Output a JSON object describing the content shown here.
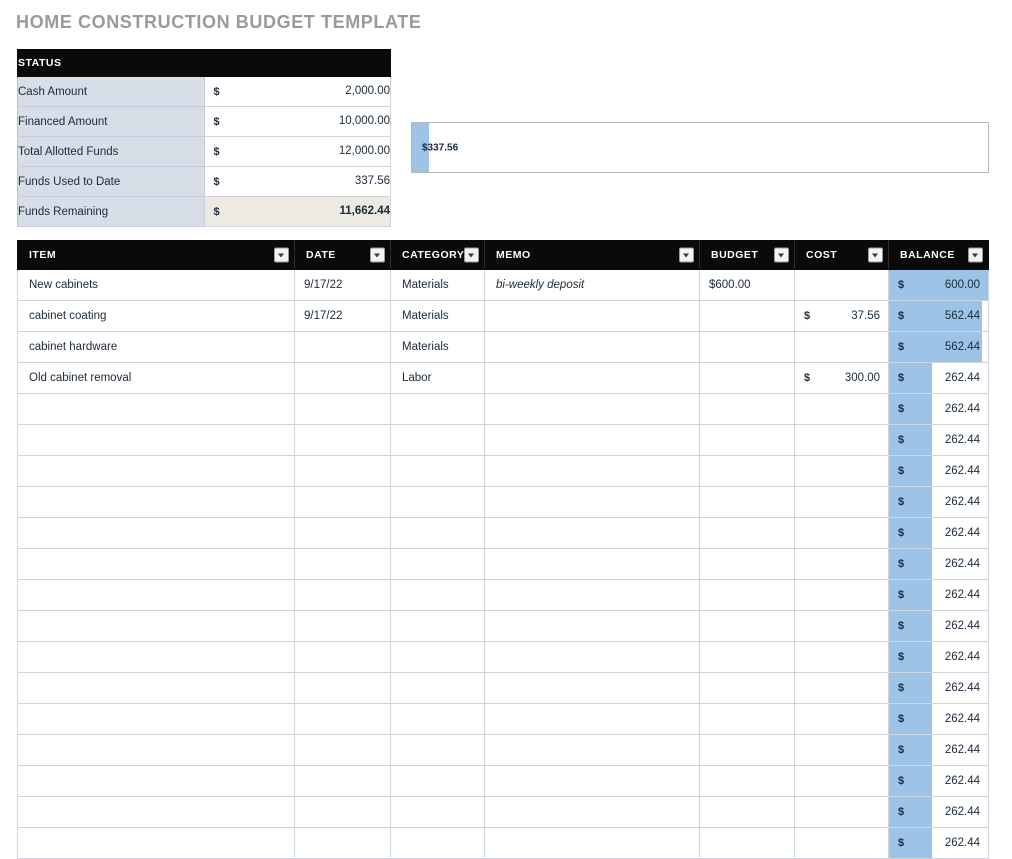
{
  "page": {
    "title": "HOME CONSTRUCTION BUDGET TEMPLATE",
    "title_color": "#9a9a9a",
    "accent_color": "#9dc3e6",
    "header_bg": "#0a0a0a",
    "row_stripe": "#d8dee8"
  },
  "status": {
    "header": "STATUS",
    "currency_symbol": "$",
    "rows": [
      {
        "label": "Cash Amount",
        "currency": "$",
        "value": "2,000.00",
        "bold": false,
        "highlight": false
      },
      {
        "label": "Financed Amount",
        "currency": "$",
        "value": "10,000.00",
        "bold": false,
        "highlight": false
      },
      {
        "label": "Total Allotted Funds",
        "currency": "$",
        "value": "12,000.00",
        "bold": false,
        "highlight": false
      },
      {
        "label": "Funds Used to Date",
        "currency": "$",
        "value": "337.56",
        "bold": false,
        "highlight": false
      },
      {
        "label": "Funds Remaining",
        "currency": "$",
        "value": "11,662.44",
        "bold": true,
        "highlight": true
      }
    ]
  },
  "chart_data": {
    "type": "bar",
    "orientation": "horizontal",
    "title": "",
    "xlabel": "",
    "ylabel": "",
    "categories": [
      "Funds Used to Date"
    ],
    "values": [
      337.56
    ],
    "data_labels": [
      "$337.56"
    ],
    "xlim": [
      0,
      12000
    ],
    "grid": false,
    "legend": false,
    "bar_color": "#9dc3e6",
    "plot_border_color": "#b7b7b7",
    "bar_fraction_of_plot": 0.03
  },
  "table": {
    "columns": [
      {
        "key": "item",
        "label": "ITEM",
        "has_filter": true
      },
      {
        "key": "date",
        "label": "DATE",
        "has_filter": true
      },
      {
        "key": "category",
        "label": "CATEGORY",
        "has_filter": true
      },
      {
        "key": "memo",
        "label": "MEMO",
        "has_filter": true
      },
      {
        "key": "budget",
        "label": "BUDGET",
        "has_filter": true
      },
      {
        "key": "cost",
        "label": "COST",
        "has_filter": true
      },
      {
        "key": "balance",
        "label": "BALANCE",
        "has_filter": true
      }
    ],
    "balance_bar_max": 600.0,
    "rows": [
      {
        "item": "New cabinets",
        "date": "9/17/22",
        "category": "Materials",
        "memo": "bi-weekly deposit",
        "budget": "$600.00",
        "cost_cur": "",
        "cost": "",
        "bal_cur": "$",
        "balance": "600.00",
        "balance_value": 600.0
      },
      {
        "item": "cabinet coating",
        "date": "9/17/22",
        "category": "Materials",
        "memo": "",
        "budget": "",
        "cost_cur": "$",
        "cost": "37.56",
        "bal_cur": "$",
        "balance": "562.44",
        "balance_value": 562.44
      },
      {
        "item": "cabinet hardware",
        "date": "",
        "category": "Materials",
        "memo": "",
        "budget": "",
        "cost_cur": "",
        "cost": "",
        "bal_cur": "$",
        "balance": "562.44",
        "balance_value": 562.44
      },
      {
        "item": "Old cabinet removal",
        "date": "",
        "category": "Labor",
        "memo": "",
        "budget": "",
        "cost_cur": "$",
        "cost": "300.00",
        "bal_cur": "$",
        "balance": "262.44",
        "balance_value": 262.44
      },
      {
        "item": "",
        "date": "",
        "category": "",
        "memo": "",
        "budget": "",
        "cost_cur": "",
        "cost": "",
        "bal_cur": "$",
        "balance": "262.44",
        "balance_value": 262.44
      },
      {
        "item": "",
        "date": "",
        "category": "",
        "memo": "",
        "budget": "",
        "cost_cur": "",
        "cost": "",
        "bal_cur": "$",
        "balance": "262.44",
        "balance_value": 262.44
      },
      {
        "item": "",
        "date": "",
        "category": "",
        "memo": "",
        "budget": "",
        "cost_cur": "",
        "cost": "",
        "bal_cur": "$",
        "balance": "262.44",
        "balance_value": 262.44
      },
      {
        "item": "",
        "date": "",
        "category": "",
        "memo": "",
        "budget": "",
        "cost_cur": "",
        "cost": "",
        "bal_cur": "$",
        "balance": "262.44",
        "balance_value": 262.44
      },
      {
        "item": "",
        "date": "",
        "category": "",
        "memo": "",
        "budget": "",
        "cost_cur": "",
        "cost": "",
        "bal_cur": "$",
        "balance": "262.44",
        "balance_value": 262.44
      },
      {
        "item": "",
        "date": "",
        "category": "",
        "memo": "",
        "budget": "",
        "cost_cur": "",
        "cost": "",
        "bal_cur": "$",
        "balance": "262.44",
        "balance_value": 262.44
      },
      {
        "item": "",
        "date": "",
        "category": "",
        "memo": "",
        "budget": "",
        "cost_cur": "",
        "cost": "",
        "bal_cur": "$",
        "balance": "262.44",
        "balance_value": 262.44
      },
      {
        "item": "",
        "date": "",
        "category": "",
        "memo": "",
        "budget": "",
        "cost_cur": "",
        "cost": "",
        "bal_cur": "$",
        "balance": "262.44",
        "balance_value": 262.44
      },
      {
        "item": "",
        "date": "",
        "category": "",
        "memo": "",
        "budget": "",
        "cost_cur": "",
        "cost": "",
        "bal_cur": "$",
        "balance": "262.44",
        "balance_value": 262.44
      },
      {
        "item": "",
        "date": "",
        "category": "",
        "memo": "",
        "budget": "",
        "cost_cur": "",
        "cost": "",
        "bal_cur": "$",
        "balance": "262.44",
        "balance_value": 262.44
      },
      {
        "item": "",
        "date": "",
        "category": "",
        "memo": "",
        "budget": "",
        "cost_cur": "",
        "cost": "",
        "bal_cur": "$",
        "balance": "262.44",
        "balance_value": 262.44
      },
      {
        "item": "",
        "date": "",
        "category": "",
        "memo": "",
        "budget": "",
        "cost_cur": "",
        "cost": "",
        "bal_cur": "$",
        "balance": "262.44",
        "balance_value": 262.44
      },
      {
        "item": "",
        "date": "",
        "category": "",
        "memo": "",
        "budget": "",
        "cost_cur": "",
        "cost": "",
        "bal_cur": "$",
        "balance": "262.44",
        "balance_value": 262.44
      },
      {
        "item": "",
        "date": "",
        "category": "",
        "memo": "",
        "budget": "",
        "cost_cur": "",
        "cost": "",
        "bal_cur": "$",
        "balance": "262.44",
        "balance_value": 262.44
      },
      {
        "item": "",
        "date": "",
        "category": "",
        "memo": "",
        "budget": "",
        "cost_cur": "",
        "cost": "",
        "bal_cur": "$",
        "balance": "262.44",
        "balance_value": 262.44
      }
    ]
  }
}
